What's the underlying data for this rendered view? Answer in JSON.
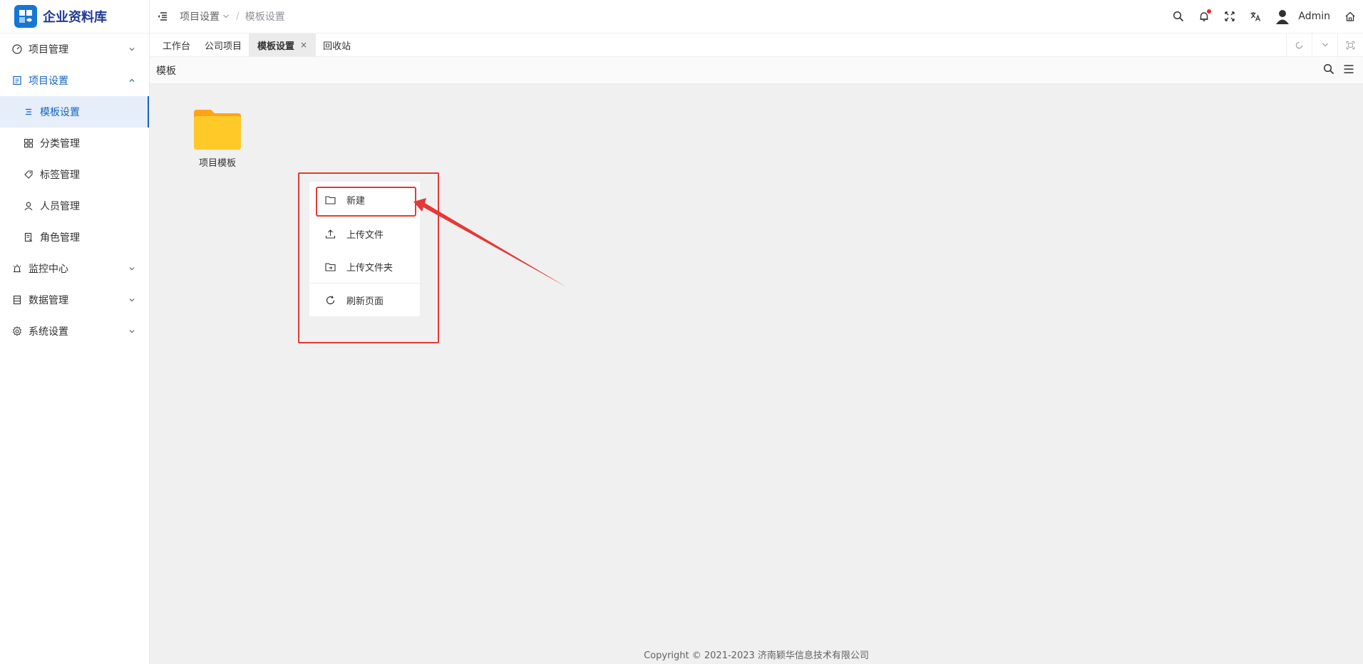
{
  "app": {
    "title": "企业资料库",
    "brand_color": "#1677d2"
  },
  "sidebar": {
    "items": [
      {
        "label": "项目管理",
        "icon": "dashboard-icon",
        "expandable": true,
        "expanded": false
      },
      {
        "label": "项目设置",
        "icon": "document-icon",
        "expandable": true,
        "expanded": true,
        "children": [
          {
            "label": "模板设置",
            "icon": "list-icon",
            "selected": true
          },
          {
            "label": "分类管理",
            "icon": "grid-icon"
          },
          {
            "label": "标签管理",
            "icon": "tag-icon"
          },
          {
            "label": "人员管理",
            "icon": "user-icon"
          },
          {
            "label": "角色管理",
            "icon": "role-icon"
          }
        ]
      },
      {
        "label": "监控中心",
        "icon": "alarm-icon",
        "expandable": true,
        "expanded": false
      },
      {
        "label": "数据管理",
        "icon": "database-icon",
        "expandable": true,
        "expanded": false
      },
      {
        "label": "系统设置",
        "icon": "gear-icon",
        "expandable": true,
        "expanded": false
      }
    ]
  },
  "header": {
    "breadcrumb": [
      "项目设置",
      "模板设置"
    ],
    "user": "Admin",
    "notification_dot": true
  },
  "tabs": [
    {
      "label": "工作台",
      "active": false
    },
    {
      "label": "公司项目",
      "active": false
    },
    {
      "label": "模板设置",
      "active": true,
      "close": "×"
    },
    {
      "label": "回收站",
      "active": false
    }
  ],
  "content": {
    "toolbar_title": "模板",
    "folders": [
      {
        "name": "项目模板"
      }
    ]
  },
  "context_menu": {
    "items": [
      {
        "label": "新建",
        "icon": "folder-icon"
      },
      {
        "label": "上传文件",
        "icon": "upload-icon"
      },
      {
        "label": "上传文件夹",
        "icon": "upload-folder-icon"
      },
      {
        "label": "刷新页面",
        "icon": "refresh-icon"
      }
    ]
  },
  "annotation": {
    "color": "#e53935"
  },
  "footer": {
    "copyright": "Copyright © 2021-2023 济南颖华信息技术有限公司"
  }
}
